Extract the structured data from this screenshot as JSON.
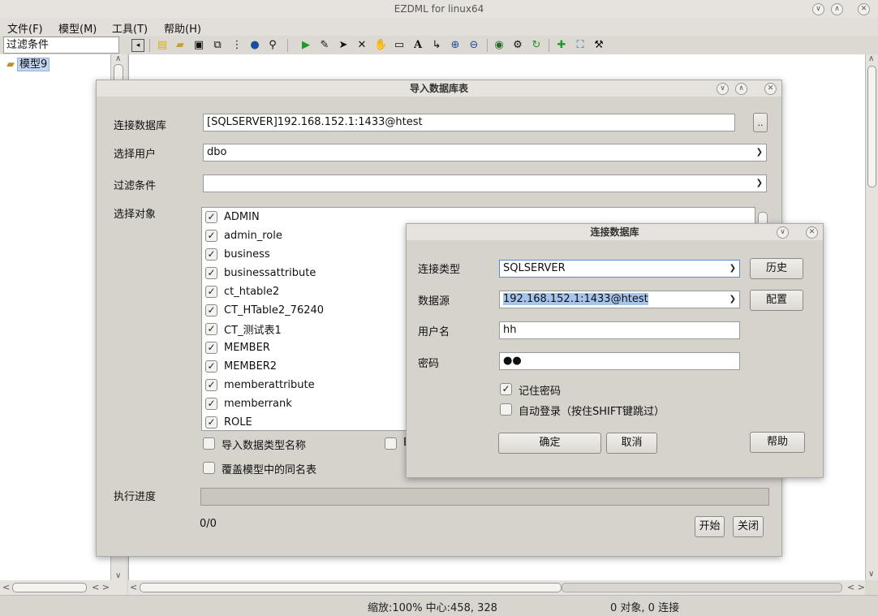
{
  "window": {
    "title": "EZDML for linux64",
    "buttons": [
      "∨",
      "∧",
      "✕"
    ]
  },
  "menu": {
    "file": "文件(F)",
    "model": "模型(M)",
    "tools": "工具(T)",
    "help": "帮助(H)"
  },
  "tree": {
    "filter_value": "过滤条件",
    "node_label": "模型9"
  },
  "status": {
    "zoom": "缩放:100% 中心:458, 328",
    "objects": "0 对象, 0 连接"
  },
  "import_dialog": {
    "title": "导入数据库表",
    "connect_label": "连接数据库",
    "connect_value": "[SQLSERVER]192.168.152.1:1433@htest",
    "browse_button": "..",
    "user_label": "选择用户",
    "user_value": "dbo",
    "filter_label": "过滤条件",
    "filter_value": "",
    "objects_label": "选择对象",
    "objects": [
      {
        "name": "ADMIN",
        "checked": true
      },
      {
        "name": "admin_role",
        "checked": true
      },
      {
        "name": "business",
        "checked": true
      },
      {
        "name": "businessattribute",
        "checked": true
      },
      {
        "name": "ct_htable2",
        "checked": true
      },
      {
        "name": "CT_HTable2_76240",
        "checked": true
      },
      {
        "name": "CT_测试表1",
        "checked": true
      },
      {
        "name": "MEMBER",
        "checked": true
      },
      {
        "name": "MEMBER2",
        "checked": true
      },
      {
        "name": "memberattribute",
        "checked": true
      },
      {
        "name": "memberrank",
        "checked": true
      },
      {
        "name": "ROLE",
        "checked": true
      }
    ],
    "option_import_type_names": "导入数据类型名称",
    "option_partial": "E",
    "option_overwrite": "覆盖模型中的同名表",
    "progress_label": "执行进度",
    "progress_text": "0/0",
    "progress_fraction": 0,
    "start_button": "开始",
    "close_button": "关闭"
  },
  "connect_dialog": {
    "title": "连接数据库",
    "type_label": "连接类型",
    "type_value": "SQLSERVER",
    "history_button": "历史",
    "source_label": "数据源",
    "source_value": "192.168.152.1:1433@htest",
    "config_button": "配置",
    "username_label": "用户名",
    "username_value": "hh",
    "password_label": "密码",
    "password_value": "●●",
    "remember_label": "记住密码",
    "remember_checked": true,
    "autologin_label": "自动登录（按住SHIFT键跳过）",
    "autologin_checked": false,
    "ok_button": "确定",
    "cancel_button": "取消",
    "help_button": "帮助"
  }
}
